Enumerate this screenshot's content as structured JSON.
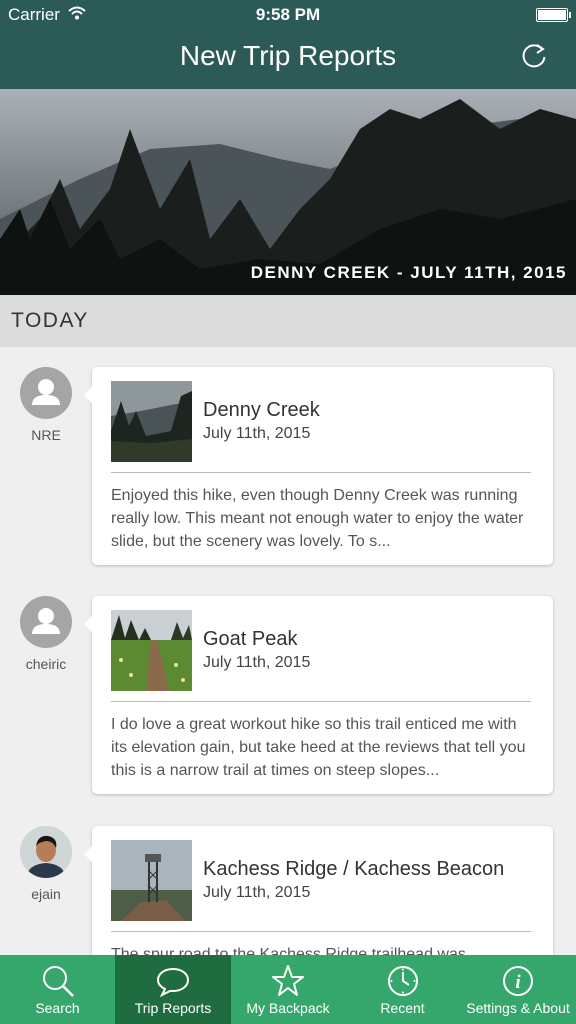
{
  "status_bar": {
    "carrier": "Carrier",
    "time": "9:58 PM"
  },
  "header": {
    "title": "New Trip Reports",
    "refresh_icon": "refresh-icon"
  },
  "hero": {
    "caption": "DENNY CREEK - JULY 11TH, 2015"
  },
  "section": {
    "label": "TODAY"
  },
  "reports": [
    {
      "user": "NRE",
      "trail": "Denny Creek",
      "date": "July 11th, 2015",
      "excerpt": "Enjoyed this hike, even though Denny Creek was running really low. This meant not enough water to enjoy the water slide, but the scenery was lovely. To s..."
    },
    {
      "user": "cheiric",
      "trail": "Goat Peak",
      "date": "July 11th, 2015",
      "excerpt": "I do love a great workout hike so this trail enticed me with its elevation gain, but take heed at the reviews that tell you this is a narrow trail at times on steep slopes..."
    },
    {
      "user": "ejain",
      "trail": "Kachess Ridge / Kachess Beacon",
      "date": "July 11th, 2015",
      "excerpt": "The spur road to the Kachess Ridge trailhead was"
    }
  ],
  "tabs": [
    {
      "label": "Search",
      "icon": "search-icon",
      "active": false
    },
    {
      "label": "Trip Reports",
      "icon": "speech-bubble-icon",
      "active": true
    },
    {
      "label": "My Backpack",
      "icon": "star-icon",
      "active": false
    },
    {
      "label": "Recent",
      "icon": "clock-icon",
      "active": false
    },
    {
      "label": "Settings & About",
      "icon": "info-icon",
      "active": false
    }
  ],
  "colors": {
    "header": "#2c5a57",
    "tabbar": "#35a76c",
    "tab_active": "#1e6c3f",
    "background": "#efefef"
  }
}
